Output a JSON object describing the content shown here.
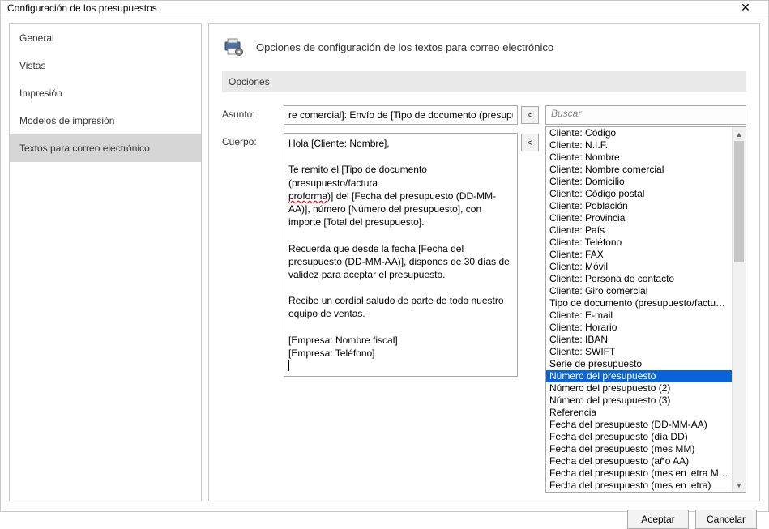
{
  "window": {
    "title": "Configuración de los presupuestos"
  },
  "sidebar": {
    "items": [
      {
        "label": "General"
      },
      {
        "label": "Vistas"
      },
      {
        "label": "Impresión"
      },
      {
        "label": "Modelos de impresión"
      },
      {
        "label": "Textos para correo electrónico"
      }
    ],
    "selected_index": 4
  },
  "header": {
    "title": "Opciones de configuración de los textos para correo electrónico"
  },
  "section": {
    "title": "Opciones"
  },
  "form": {
    "subject_label": "Asunto:",
    "subject_value": "re comercial]: Envío de [Tipo de documento (presupu",
    "body_label": "Cuerpo:",
    "body_segments": [
      {
        "text": "Hola [Cliente: Nombre],"
      },
      {
        "text": ""
      },
      {
        "text": "Te remito el [Tipo de documento (presupuesto/factura "
      },
      {
        "text_pre": "",
        "squiggle": "proforma",
        "text_post": ")] del [Fecha del presupuesto (DD-MM-AA)], número [Número del presupuesto], con importe [Total del presupuesto]."
      },
      {
        "text": ""
      },
      {
        "text": "Recuerda que desde la fecha [Fecha del presupuesto (DD-MM-AA)], dispones de 30 días de validez para aceptar el presupuesto."
      },
      {
        "text": ""
      },
      {
        "text": "Recibe un cordial saludo de parte de todo nuestro equipo de ventas."
      },
      {
        "text": ""
      },
      {
        "text": "[Empresa: Nombre fiscal]"
      },
      {
        "text": "[Empresa: Teléfono]"
      }
    ],
    "insert_subject_btn": "<",
    "insert_body_btn": "<"
  },
  "fieldlist": {
    "search_placeholder": "Buscar",
    "selected_index": 18,
    "items": [
      "Cliente: Código",
      "Cliente: N.I.F.",
      "Cliente: Nombre",
      "Cliente: Nombre comercial",
      "Cliente: Domicilio",
      "Cliente: Código postal",
      "Cliente: Población",
      "Cliente: Provincia",
      "Cliente: País",
      "Cliente: Teléfono",
      "Cliente: FAX",
      "Cliente: Móvil",
      "Cliente: Persona de contacto",
      "Cliente: Giro comercial",
      "Tipo de documento (presupuesto/factura pro",
      "Cliente: E-mail",
      "Cliente: Horario",
      "Cliente: IBAN",
      "Cliente: SWIFT",
      "Serie de presupuesto",
      "Número del presupuesto",
      "Número del presupuesto (2)",
      "Número del presupuesto (3)",
      "Referencia",
      "Fecha del presupuesto (DD-MM-AA)",
      "Fecha del presupuesto (día DD)",
      "Fecha del presupuesto (mes MM)",
      "Fecha del presupuesto (año AA)",
      "Fecha del presupuesto (mes en letra MMM)",
      "Fecha del presupuesto (mes en letra)"
    ]
  },
  "footer": {
    "ok_label": "Aceptar",
    "cancel_label": "Cancelar"
  }
}
